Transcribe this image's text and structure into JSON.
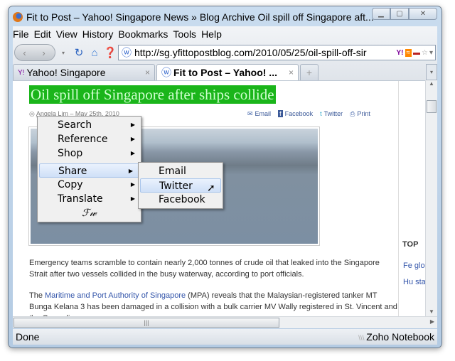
{
  "window": {
    "title": "Fit to Post – Yahoo! Singapore News » Blog Archive Oil spill off Singapore aft...",
    "controls": [
      "minimize",
      "maximize",
      "close"
    ]
  },
  "menubar": [
    "File",
    "Edit",
    "View",
    "History",
    "Bookmarks",
    "Tools",
    "Help"
  ],
  "navbar": {
    "url": "http://sg.yfittopostblog.com/2010/05/25/oil-spill-off-sir"
  },
  "tabs": [
    {
      "label": "Yahoo! Singapore",
      "active": false
    },
    {
      "label": "Fit to Post – Yahoo! ...",
      "active": true
    }
  ],
  "article": {
    "headline": "Oil spill off Singapore after ships collide",
    "byline": "Angela Lim – May 25th, 2010",
    "share": [
      "Email",
      "Facebook",
      "Twitter",
      "Print"
    ],
    "para1": "Emergency teams scramble to contain nearly 2,000 tonnes of crude oil that leaked into the Singapore Strait after two vessels collided in the busy waterway, according to port officials.",
    "para2_pre": "The ",
    "para2_link": "Maritime and Port Authority of Singapore",
    "para2_post": " (MPA) reveals that the Malaysian-registered tanker MT Bunga Kelana 3 has been damaged in a collision with a bulk carrier MV Wally registered in St. Vincent and the Grenadines."
  },
  "sidebar": {
    "heading": "TOP",
    "items": [
      "Fe glo",
      "Hu sta"
    ]
  },
  "context_menu": {
    "items": [
      "Search",
      "Reference",
      "Shop",
      "Share",
      "Copy",
      "Translate"
    ],
    "footer_glyph": "ℱ𝓌"
  },
  "submenu": {
    "items": [
      "Email",
      "Twitter",
      "Facebook"
    ]
  },
  "status": {
    "text": "Done",
    "addon": "Zoho Notebook"
  }
}
